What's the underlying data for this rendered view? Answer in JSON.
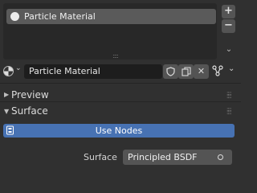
{
  "material_slots": {
    "items": [
      {
        "label": "Particle Material"
      }
    ],
    "add_symbol": "+",
    "remove_symbol": "−",
    "dropdown_symbol": "⌄",
    "grip_symbol": "::::"
  },
  "datablock": {
    "name": "Particle Material",
    "fake_user_icon": "shield-icon",
    "duplicate_icon": "copy-icon",
    "unlink_symbol": "✕",
    "browse_symbol": "⌄",
    "node_type_icon": "node-tree-icon"
  },
  "panels": {
    "preview": {
      "title": "Preview",
      "expanded": false
    },
    "surface": {
      "title": "Surface",
      "expanded": true
    }
  },
  "surface": {
    "use_nodes_label": "Use Nodes",
    "surface_label": "Surface",
    "shader_value": "Principled BSDF"
  },
  "colors": {
    "accent": "#4772b3",
    "background": "#303030",
    "field": "#1d1d1d",
    "button": "#545454"
  }
}
